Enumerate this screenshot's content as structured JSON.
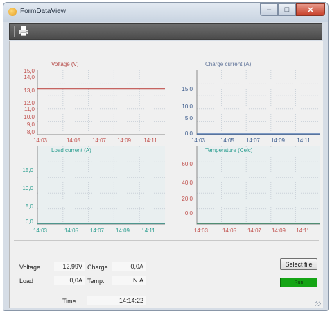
{
  "window": {
    "title": "FormDataView"
  },
  "toolbar": {
    "print_icon": "printer-icon"
  },
  "colors": {
    "voltage": "#c0504d",
    "charge": "#3a66a8",
    "load": "#2a9d8f",
    "temperature": "#2f8f63",
    "run_button": "#15a515"
  },
  "charts": [
    {
      "title": "Voltage (V)",
      "y_ticks": [
        "15,0",
        "14,0",
        "13,0",
        "12,0",
        "11,0",
        "10,0",
        "9,0",
        "8,0"
      ],
      "x_ticks": [
        "14:03",
        "14:05",
        "14:07",
        "14:09",
        "14:11"
      ]
    },
    {
      "title": "Charge current (A)",
      "y_ticks": [
        "15,0",
        "10,0",
        "5,0",
        "0,0"
      ],
      "x_ticks": [
        "14:03",
        "14:05",
        "14:07",
        "14:09",
        "14:11"
      ]
    },
    {
      "title": "Load current (A)",
      "y_ticks": [
        "15,0",
        "10,0",
        "5,0",
        "0,0"
      ],
      "x_ticks": [
        "14:03",
        "14:05",
        "14:07",
        "14:09",
        "14:11"
      ]
    },
    {
      "title": "Temperature (Celc)",
      "y_ticks": [
        "60,0",
        "40,0",
        "20,0",
        "0,0"
      ],
      "x_ticks": [
        "14:03",
        "14:05",
        "14:07",
        "14:09",
        "14:11"
      ]
    }
  ],
  "chart_data": [
    {
      "type": "line",
      "title": "Voltage (V)",
      "x": [
        "14:03",
        "14:13"
      ],
      "values": [
        12.99,
        12.99
      ],
      "ylim": [
        8,
        15
      ]
    },
    {
      "type": "line",
      "title": "Charge current (A)",
      "x": [
        "14:03",
        "14:13"
      ],
      "values": [
        0,
        0
      ],
      "ylim": [
        0,
        15
      ]
    },
    {
      "type": "line",
      "title": "Load current (A)",
      "x": [
        "14:03",
        "14:13"
      ],
      "values": [
        0,
        0
      ],
      "ylim": [
        0,
        15
      ]
    },
    {
      "type": "line",
      "title": "Temperature (Celc)",
      "x": [
        "14:03",
        "14:13"
      ],
      "values": [
        0,
        0
      ],
      "ylim": [
        0,
        60
      ]
    }
  ],
  "status": {
    "voltage_label": "Voltage",
    "voltage_value": "12,99V",
    "charge_label": "Charge",
    "charge_value": "0,0A",
    "load_label": "Load",
    "load_value": "0,0A",
    "temp_label": "Temp.",
    "temp_value": "N.A",
    "time_label": "Time",
    "time_value": "14:14:22"
  },
  "buttons": {
    "select_file": "Select file",
    "run": "Run"
  }
}
